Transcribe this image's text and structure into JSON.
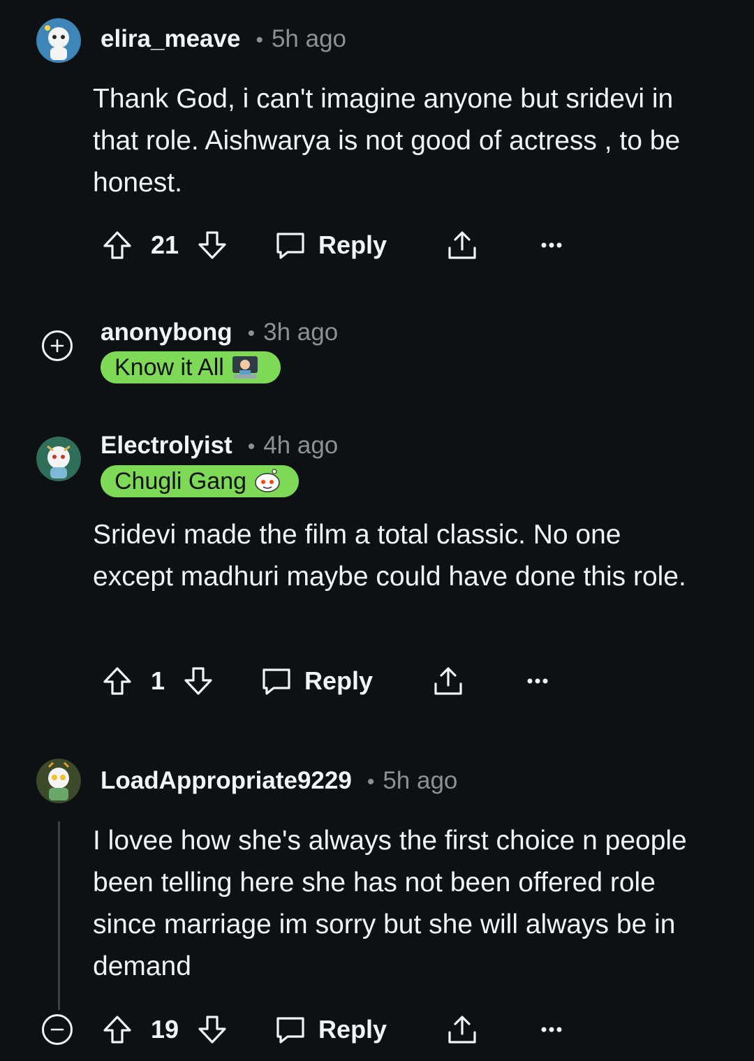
{
  "comments": [
    {
      "username": "elira_meave",
      "time": "5h ago",
      "text": "Thank God, i can't imagine anyone but sridevi in that role. Aishwarya is not good of actress , to be honest.",
      "score": "21",
      "reply_label": "Reply"
    },
    {
      "username": "anonybong",
      "time": "3h ago",
      "flair": "Know it All"
    },
    {
      "username": "Electrolyist",
      "time": "4h ago",
      "flair": "Chugli Gang",
      "text": "Sridevi made the film a total classic. No one except madhuri maybe could have done this role.",
      "score": "1",
      "reply_label": "Reply"
    },
    {
      "username": "LoadAppropriate9229",
      "time": "5h ago",
      "text": "I lovee how she's always the first choice n people been telling here she has not been offered role since marriage im sorry but she will always be in demand",
      "score": "19",
      "reply_label": "Reply"
    }
  ],
  "colors": {
    "background": "#0e1113",
    "text": "#f2f4f5",
    "muted": "#8a9296",
    "flair": "#7ed957"
  },
  "icons": [
    "upvote-icon",
    "downvote-icon",
    "comment-bubble-icon",
    "share-icon",
    "more-options-icon",
    "expand-icon",
    "collapse-icon"
  ]
}
